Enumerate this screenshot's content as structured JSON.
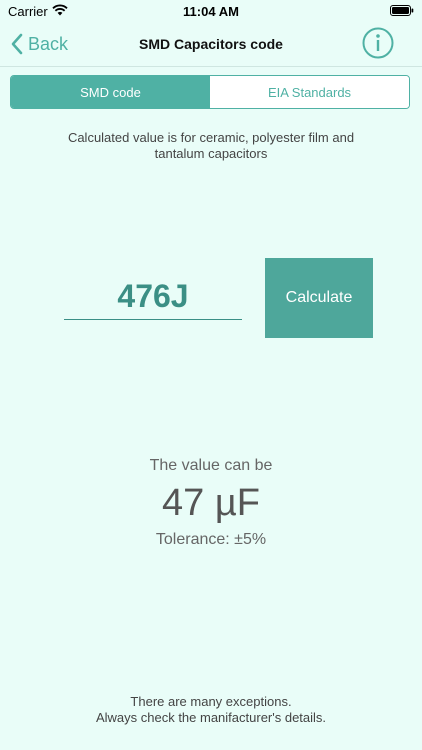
{
  "status_bar": {
    "carrier": "Carrier",
    "time": "11:04 AM"
  },
  "nav": {
    "back_label": "Back",
    "title": "SMD Capacitors code",
    "info_icon": "info-circle-icon"
  },
  "tabs": [
    {
      "label": "SMD code",
      "active": true
    },
    {
      "label": "EIA Standards",
      "active": false
    }
  ],
  "note": {
    "line1": "Calculated value is for ceramic, polyester film and",
    "line2": "tantalum capacitors"
  },
  "input": {
    "value": "476J"
  },
  "calculate_label": "Calculate",
  "result": {
    "heading": "The value can be",
    "value": "47 µF",
    "tolerance": "Tolerance: ±5%"
  },
  "footer": {
    "line1": "There are many exceptions.",
    "line2": "Always check the manifacturer's details."
  },
  "colors": {
    "accent": "#4fb1a4",
    "background": "#e9fdf8",
    "button": "#4ea79b"
  }
}
